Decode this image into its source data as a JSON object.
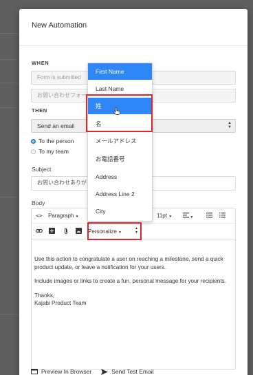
{
  "modal": {
    "title": "New Automation",
    "when_label": "WHEN",
    "when_trigger_placeholder": "Form is submitted",
    "when_form_placeholder": "お問い合わせフォーム",
    "then_label": "THEN",
    "action_select_value": "Send an email",
    "radio_to_person": "To the person",
    "radio_to_team": "To my team",
    "subject_label": "Subject",
    "subject_value": "お問い合わせありがと",
    "body_label": "Body"
  },
  "editor": {
    "paragraph_label": "Paragraph",
    "font_size_label": "11pt",
    "personalize_label": "Personalize",
    "body_lines": [
      "Use this action to congratulate a user on reaching a milestone, send a quick product update, or leave a notification for your users.",
      "Include images or links to create a fun, personal message for your recipients.",
      "Thanks,",
      "Kajabi Product Team"
    ]
  },
  "dropdown": {
    "items": [
      "First Name",
      "Last Name",
      "姓",
      "名",
      "メールアドレス",
      "お電話番号",
      "Address",
      "Address Line 2",
      "City"
    ],
    "selected_item": "First Name",
    "hovered_item": "姓"
  },
  "footer": {
    "preview_label": "Preview In Browser",
    "send_test_label": "Send Test Email"
  },
  "colors": {
    "accent": "#2f86f6",
    "highlight": "#e0262c"
  }
}
